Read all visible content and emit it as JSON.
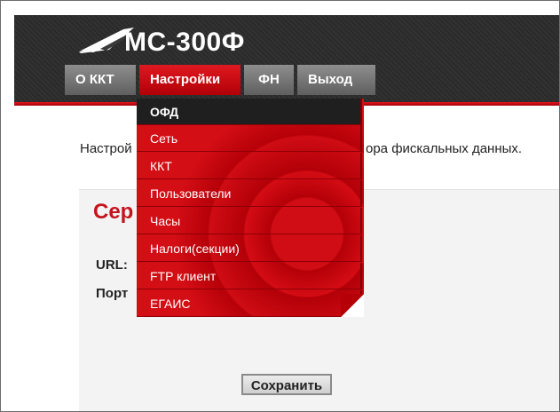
{
  "app": {
    "title": "МС-300Ф"
  },
  "nav": {
    "tabs": [
      {
        "label": "О ККТ"
      },
      {
        "label": "Настройки",
        "active": true
      },
      {
        "label": "ФН"
      },
      {
        "label": "Выход"
      }
    ]
  },
  "dropdown": {
    "items": [
      {
        "label": "ОФД",
        "active": true
      },
      {
        "label": "Сеть"
      },
      {
        "label": "ККТ"
      },
      {
        "label": "Пользователи"
      },
      {
        "label": "Часы"
      },
      {
        "label": "Налоги(секции)"
      },
      {
        "label": "FTP клиент"
      },
      {
        "label": "ЕГАИС"
      }
    ]
  },
  "content": {
    "intro_left": "Настрой",
    "intro_right": "ора фискальных данных.",
    "section_title": "Сер",
    "url_label": "URL:",
    "port_label": "Порт",
    "save_label": "Сохранить"
  },
  "colors": {
    "accent": "#d00d14",
    "header_bg": "#2e2e2e",
    "tab_gray": "#767676"
  },
  "icons": {
    "logo": "bird-swoosh-logo"
  }
}
